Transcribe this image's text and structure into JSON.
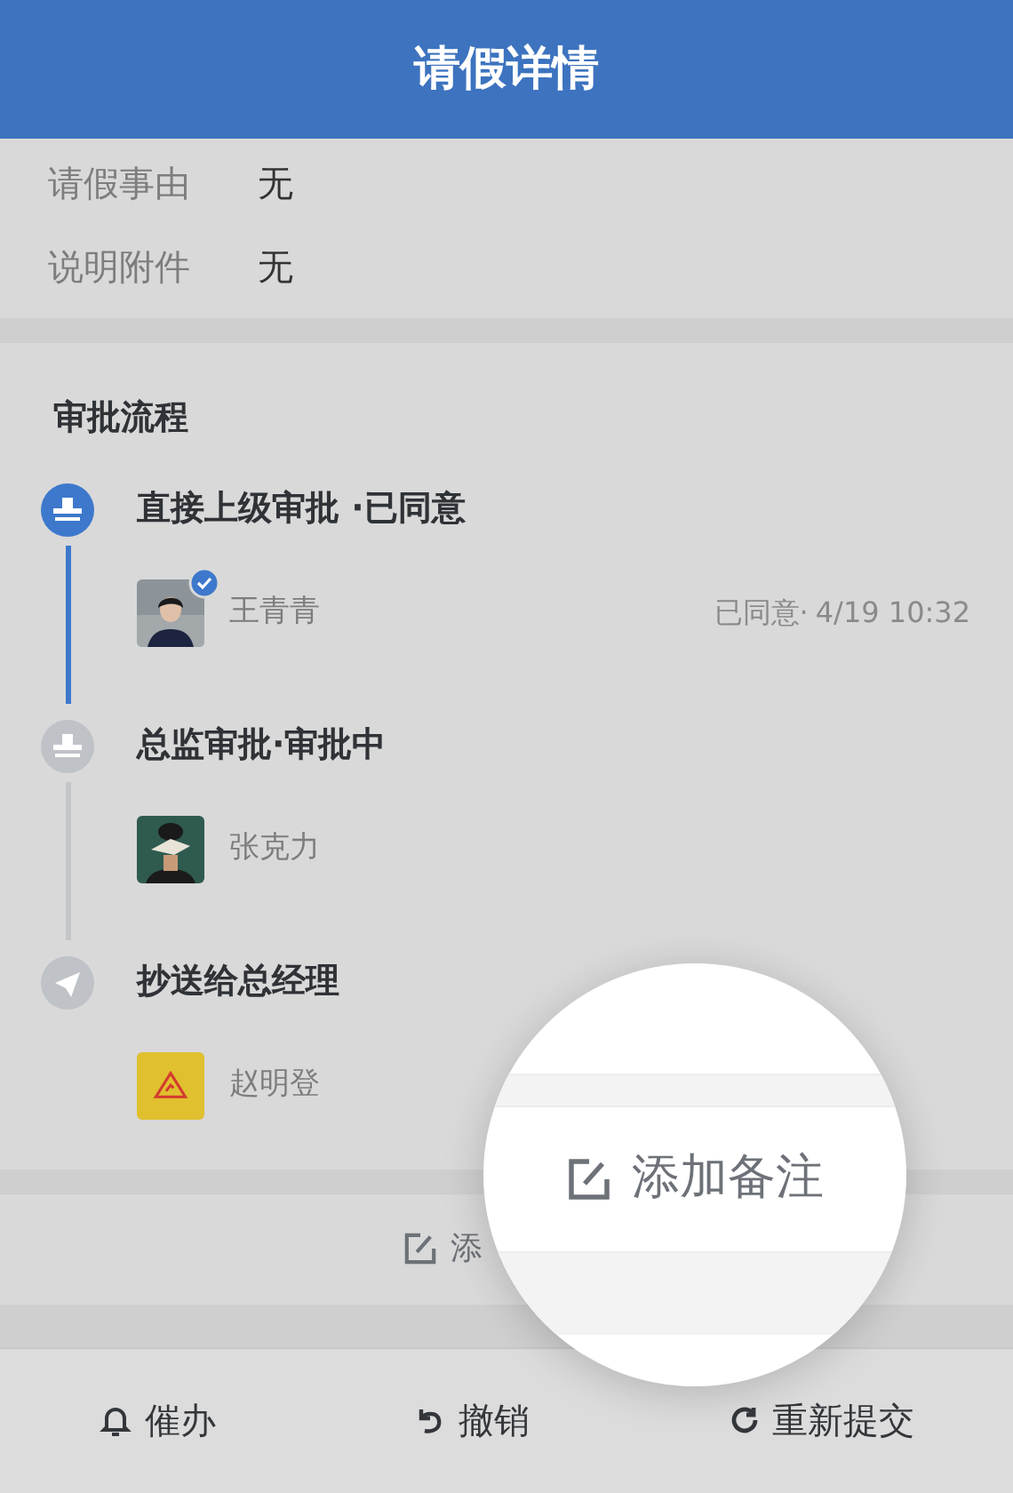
{
  "header": {
    "title": "请假详情"
  },
  "fields": [
    {
      "label": "请假事由",
      "value": "无"
    },
    {
      "label": "说明附件",
      "value": "无"
    }
  ],
  "approval": {
    "title": "审批流程",
    "steps": [
      {
        "kind": "approve",
        "title": "直接上级审批 ·已同意",
        "done": true,
        "person": {
          "name": "王青青",
          "kind": "picture",
          "approved": true
        },
        "status": "已同意·",
        "time": "4/19 10:32"
      },
      {
        "kind": "approve",
        "title": "总监审批·审批中",
        "done": false,
        "person": {
          "name": "张克力",
          "kind": "picture"
        }
      },
      {
        "kind": "cc",
        "title": "抄送给总经理",
        "person": {
          "name": "赵明登",
          "kind": "icon"
        }
      }
    ]
  },
  "note_button": {
    "label": "添"
  },
  "magnifier": {
    "label": "添加备注"
  },
  "actions": [
    {
      "kind": "remind",
      "label": "催办"
    },
    {
      "kind": "revoke",
      "label": "撤销"
    },
    {
      "kind": "resubmit",
      "label": "重新提交"
    }
  ]
}
